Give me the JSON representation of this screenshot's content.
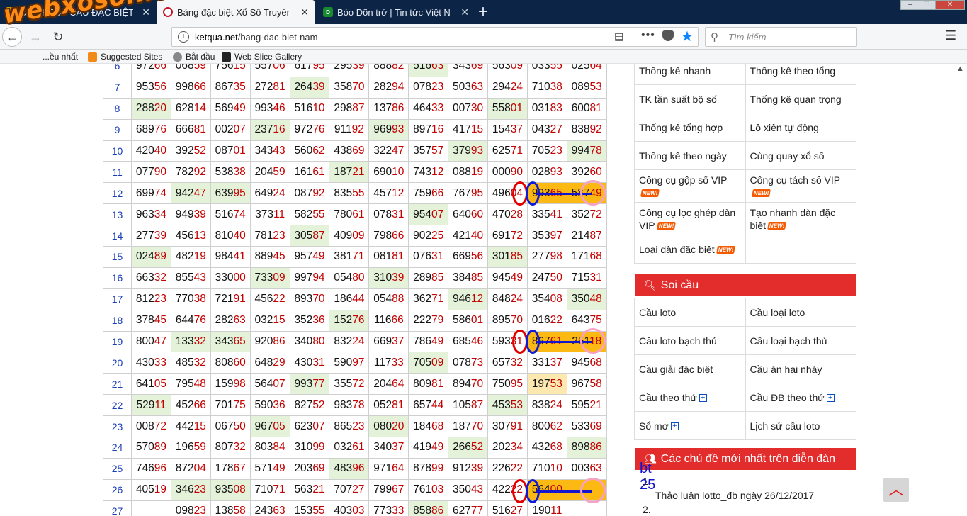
{
  "browser": {
    "tabs": [
      {
        "title": "CẦU KÈO - CẦU ĐẶC BIỆT",
        "icon": "xs-favicon",
        "active": false
      },
      {
        "title": "Bảng đặc biệt Xổ Số Truyền Thố",
        "icon": "swirl-favicon",
        "active": true
      },
      {
        "title": "Bỏo Dõn trớ | Tin tức Việt Na",
        "icon": "d-favicon",
        "active": false
      }
    ],
    "new_tab_label": "+",
    "url_domain": "ketqua.net",
    "url_path": "/bang-dac-biet-nam",
    "search_placeholder": "Tìm kiếm",
    "bookmarks": [
      {
        "label": "Most Visited",
        "visible_text": "...ều nhất"
      },
      {
        "label": "Suggested Sites"
      },
      {
        "label": "Bắt đầu"
      },
      {
        "label": "Web Slice Gallery"
      }
    ],
    "watermark": "webxoso.net"
  },
  "table": {
    "rows": [
      {
        "idx": "6",
        "cells": [
          "97266",
          "06859",
          "75615",
          "55706",
          "61795",
          "29539",
          "88882",
          "51663",
          "34369",
          "56309",
          "03355",
          "02564"
        ],
        "green": [
          7
        ]
      },
      {
        "idx": "7",
        "cells": [
          "95356",
          "99866",
          "86735",
          "27281",
          "26439",
          "35870",
          "28294",
          "07823",
          "50363",
          "29424",
          "71038",
          "08953"
        ],
        "green": [
          4
        ]
      },
      {
        "idx": "8",
        "cells": [
          "28820",
          "62814",
          "56949",
          "99346",
          "51610",
          "29887",
          "13786",
          "46433",
          "00730",
          "55801",
          "03183",
          "60081"
        ],
        "green": [
          0,
          9
        ]
      },
      {
        "idx": "9",
        "cells": [
          "68976",
          "66681",
          "00207",
          "23716",
          "97276",
          "91192",
          "96993",
          "89716",
          "41715",
          "15437",
          "04327",
          "83892"
        ],
        "green": [
          3,
          6
        ]
      },
      {
        "idx": "10",
        "cells": [
          "42040",
          "39252",
          "08701",
          "34343",
          "56062",
          "43869",
          "32247",
          "35757",
          "37993",
          "62571",
          "70523",
          "99478"
        ],
        "green": [
          8,
          11
        ]
      },
      {
        "idx": "11",
        "cells": [
          "07790",
          "78292",
          "53838",
          "20459",
          "16161",
          "18721",
          "69010",
          "74312",
          "08819",
          "00090",
          "02893",
          "39260"
        ],
        "green": [
          5
        ]
      },
      {
        "idx": "12",
        "cells": [
          "69974",
          "94247",
          "63995",
          "64924",
          "08792",
          "83555",
          "45712",
          "75966",
          "76795",
          "49604",
          "99365",
          "58749"
        ],
        "green": [
          1,
          2
        ],
        "orange": [
          10,
          11
        ]
      },
      {
        "idx": "13",
        "cells": [
          "96334",
          "94939",
          "51674",
          "37311",
          "58255",
          "78061",
          "07831",
          "95407",
          "64060",
          "47028",
          "33541",
          "35272"
        ],
        "green": [
          7
        ]
      },
      {
        "idx": "14",
        "cells": [
          "27739",
          "45613",
          "81040",
          "78123",
          "30587",
          "40909",
          "79866",
          "90225",
          "42140",
          "69172",
          "35397",
          "21487"
        ],
        "green": [
          4
        ]
      },
      {
        "idx": "15",
        "cells": [
          "02489",
          "48219",
          "98441",
          "88945",
          "95749",
          "38171",
          "08181",
          "07631",
          "66956",
          "30185",
          "27798",
          "17168"
        ],
        "green": [
          0,
          9
        ]
      },
      {
        "idx": "16",
        "cells": [
          "66332",
          "85543",
          "33000",
          "73309",
          "99794",
          "05480",
          "31039",
          "28985",
          "38485",
          "94549",
          "24750",
          "71531"
        ],
        "green": [
          3,
          6
        ]
      },
      {
        "idx": "17",
        "cells": [
          "81223",
          "77038",
          "72191",
          "45622",
          "89370",
          "18644",
          "05488",
          "36271",
          "94612",
          "84824",
          "35408",
          "35048"
        ],
        "green": [
          8,
          11
        ]
      },
      {
        "idx": "18",
        "cells": [
          "37845",
          "64476",
          "28263",
          "03215",
          "35236",
          "15276",
          "11666",
          "22279",
          "58601",
          "89570",
          "01622",
          "64375"
        ],
        "green": [
          5
        ]
      },
      {
        "idx": "19",
        "cells": [
          "80047",
          "13332",
          "34365",
          "92086",
          "34080",
          "83224",
          "66937",
          "78649",
          "68546",
          "59331",
          "86761",
          "25118"
        ],
        "green": [
          1,
          2
        ],
        "orange": [
          10,
          11
        ]
      },
      {
        "idx": "20",
        "cells": [
          "43033",
          "48532",
          "80860",
          "64829",
          "43031",
          "59097",
          "11733",
          "70509",
          "07873",
          "65732",
          "33137",
          "94568"
        ],
        "green": [
          7
        ]
      },
      {
        "idx": "21",
        "cells": [
          "64105",
          "79548",
          "15998",
          "56407",
          "99377",
          "35572",
          "20464",
          "80981",
          "89470",
          "75095",
          "19753",
          "96758"
        ],
        "green": [
          4
        ],
        "yellow": [
          10
        ]
      },
      {
        "idx": "22",
        "cells": [
          "52911",
          "45266",
          "70175",
          "59036",
          "82752",
          "98378",
          "05281",
          "65744",
          "10587",
          "45353",
          "83824",
          "59521"
        ],
        "green": [
          0,
          9
        ]
      },
      {
        "idx": "23",
        "cells": [
          "00872",
          "44215",
          "06750",
          "96705",
          "62307",
          "86523",
          "08020",
          "18468",
          "18770",
          "30791",
          "80062",
          "53369"
        ],
        "green": [
          3,
          6
        ]
      },
      {
        "idx": "24",
        "cells": [
          "57089",
          "19659",
          "80732",
          "80384",
          "31099",
          "03261",
          "34037",
          "41949",
          "26652",
          "20234",
          "43268",
          "89886"
        ],
        "green": [
          8,
          11
        ]
      },
      {
        "idx": "25",
        "cells": [
          "74696",
          "87204",
          "17867",
          "57149",
          "20369",
          "48396",
          "97164",
          "87899",
          "91239",
          "22622",
          "71010",
          "00363"
        ],
        "green": [
          5
        ]
      },
      {
        "idx": "26",
        "cells": [
          "40519",
          "34623",
          "93508",
          "71071",
          "56321",
          "70727",
          "79967",
          "76103",
          "35043",
          "42222",
          "56400",
          ""
        ],
        "green": [
          1,
          2
        ],
        "orange": [
          10,
          11
        ]
      },
      {
        "idx": "27",
        "cells": [
          "",
          "09823",
          "13858",
          "24363",
          "15355",
          "40303",
          "77333",
          "85886",
          "62777",
          "51627",
          "19011",
          ""
        ],
        "green": [
          7
        ]
      }
    ],
    "annotation_text": "bt 25"
  },
  "sidebar": {
    "stats_menu": [
      [
        {
          "label": "Thống kê nhanh"
        },
        {
          "label": "Thống kê theo tổng"
        }
      ],
      [
        {
          "label": "TK tần suất bộ số"
        },
        {
          "label": "Thống kê quan trọng"
        }
      ],
      [
        {
          "label": "Thống kê tổng hợp"
        },
        {
          "label": "Lô xiên tự động"
        }
      ],
      [
        {
          "label": "Thống kê theo ngày"
        },
        {
          "label": "Cùng quay xổ số"
        }
      ],
      [
        {
          "label": "Công cụ gộp số VIP",
          "badge": "NEW!"
        },
        {
          "label": "Công cụ tách số VIP",
          "badge": "NEW!"
        }
      ],
      [
        {
          "label": "Công cụ lọc ghép dàn VIP",
          "badge": "NEW!"
        },
        {
          "label": "Tạo nhanh dàn đặc biệt",
          "badge": "NEW!"
        }
      ],
      [
        {
          "label": "Loại dàn đặc biệt",
          "badge": "NEW!"
        },
        {
          "label": ""
        }
      ]
    ],
    "soi_cau_title": "Soi cầu",
    "soi_cau_menu": [
      [
        {
          "label": "Cầu loto"
        },
        {
          "label": "Cầu loại loto"
        }
      ],
      [
        {
          "label": "Cầu loto bạch thủ"
        },
        {
          "label": "Cầu loại bạch thủ"
        }
      ],
      [
        {
          "label": "Cầu giải đặc biệt"
        },
        {
          "label": "Cầu ăn hai nháy"
        }
      ],
      [
        {
          "label": "Cầu theo thứ",
          "expand": true
        },
        {
          "label": "Cầu ĐB theo thứ",
          "expand": true
        }
      ],
      [
        {
          "label": "Sổ mơ",
          "expand": true
        },
        {
          "label": "Lịch sử cầu loto"
        }
      ]
    ],
    "forum_title": "Các chủ đề mới nhất trên diễn đàn",
    "forum_items": [
      {
        "num": "1.",
        "text": "Thảo luận lotto_đb ngày 26/12/2017"
      },
      {
        "num": "2.",
        "text": ""
      }
    ]
  },
  "colors": {
    "highlight_green": "#e4f2d9",
    "highlight_orange": "#fdb913",
    "highlight_yellow": "#fde9b0",
    "panel_red": "#e32d2d",
    "index_blue": "#1a3fb8",
    "tail_red": "#c40000"
  }
}
